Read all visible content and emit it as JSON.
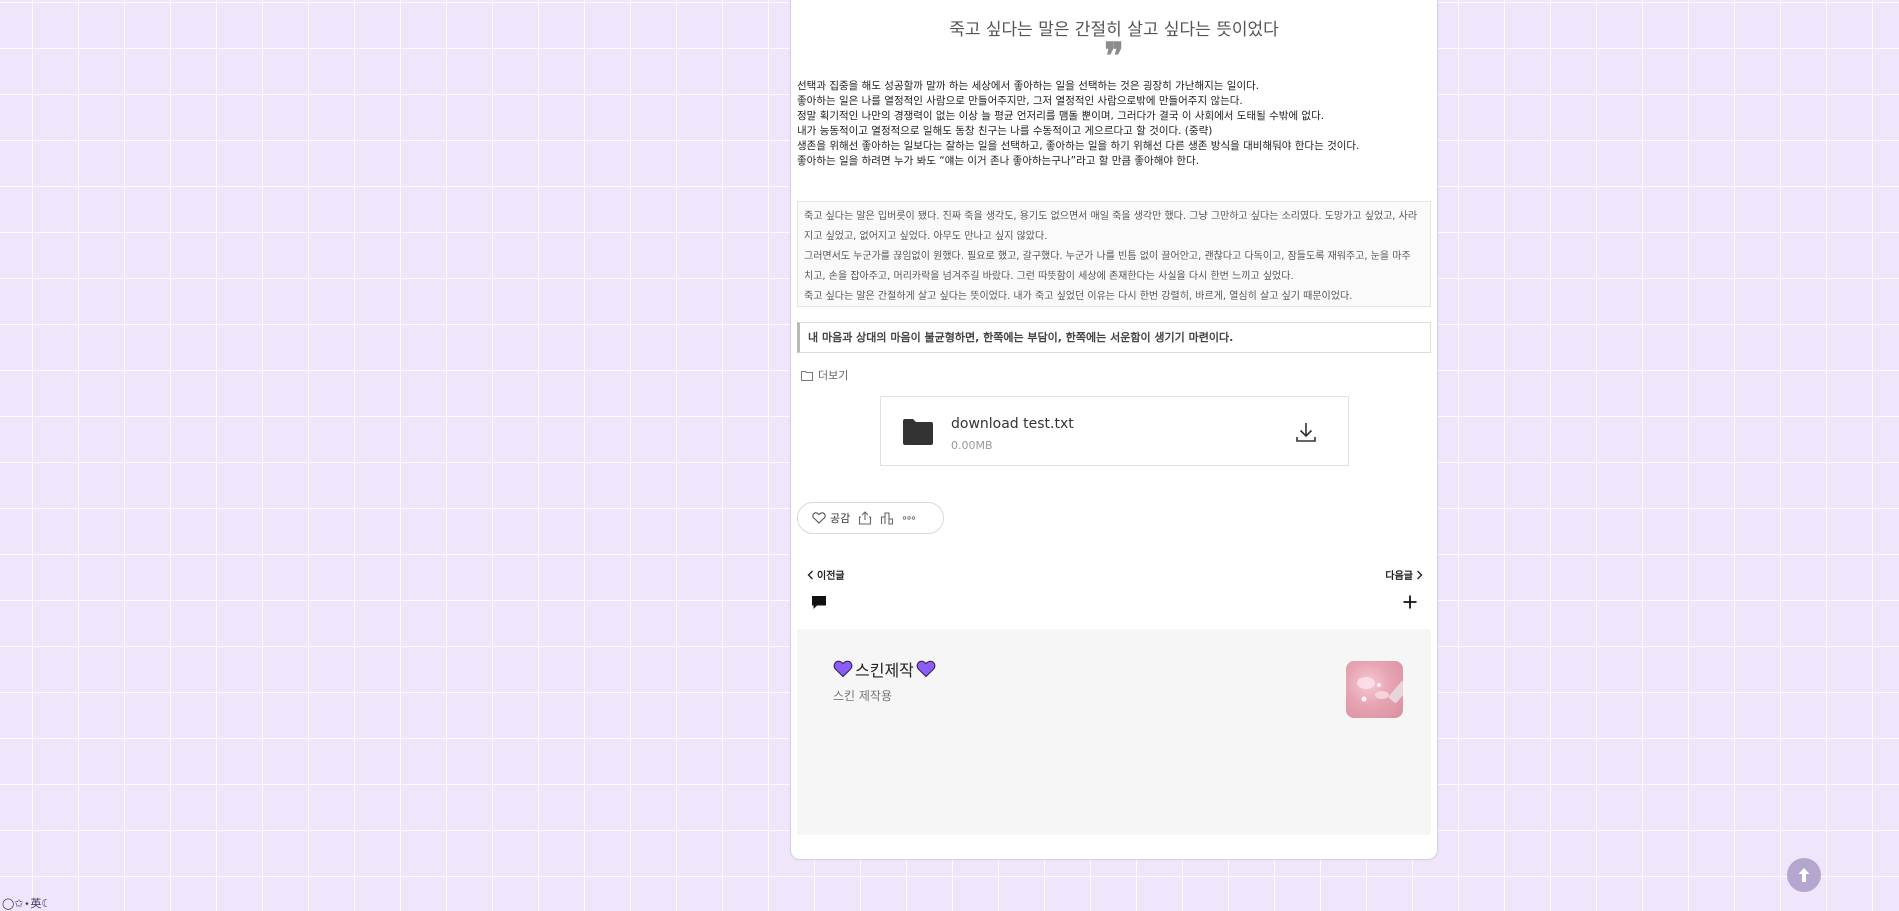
{
  "post": {
    "subtitle": "죽고 싶다는 말은 간절히 살고 싶다는 뜻이었다",
    "quote_mark": "❞",
    "quote_lines": [
      "선택과 집중을 해도 성공할까 말까 하는 세상에서 좋아하는 일을 선택하는 것은 굉장히 가난해지는 일이다.",
      "좋아하는 일은 나를 열정적인 사람으로 만들어주지만, 그저 열정적인 사람으로밖에 만들어주지 않는다.",
      "정말 획기적인 나만의 경쟁력이 없는 이상 늘 평균 언저리를 맴돌 뿐이며, 그러다가 결국 이 사회에서 도태될 수밖에 없다.",
      "내가 능동적이고 열정적으로 일해도 동창 친구는 나를 수동적이고 게으르다고 할 것이다. (중략)",
      "생존을 위해선 좋아하는 일보다는 잘하는 일을 선택하고, 좋아하는 일을 하기 위해선 다른 생존 방식을 대비해둬야 한다는 것이다.",
      "좋아하는 일을 하려면 누가 봐도 “얘는 이거 존나 좋아하는구나”라고 할 만큼 좋아해야 한다."
    ],
    "story_lines": [
      "죽고 싶다는 말은 입버릇이 됐다. 진짜 죽을 생각도, 용기도 없으면서 매일 죽을 생각만 했다. 그냥 그만하고 싶다는 소리였다. 도망가고 싶었고, 사라",
      "지고 싶었고, 없어지고 싶었다. 아무도 만나고 싶지 않았다.",
      "그러면서도 누군가를 끊임없이 원했다. 필요로 했고, 갈구했다. 누군가 나를 빈틈 없이 끌어안고, 괜찮다고 다독이고, 잠들도록 재워주고, 눈을 마주",
      "치고, 손을 잡아주고, 머리카락을 넘겨주길 바랐다. 그런 따뜻함이 세상에 존재한다는 사실을 다시 한번 느끼고 싶었다.",
      "죽고 싶다는 말은 간절하게 살고 싶다는 뜻이었다. 내가 죽고 싶었던 이유는 다시 한번 강렬히, 바르게, 열심히 살고 싶기 때문이었다."
    ],
    "highlight": "내 마음과 상대의 마음이 불균형하면, 한쪽에는 부담이, 한쪽에는 서운함이 생기기 마련이다.",
    "more_label": "더보기"
  },
  "attachment": {
    "file_name": "download test.txt",
    "file_size": "0.00MB"
  },
  "reactions": {
    "like_label": "공감",
    "icons": [
      "heart-icon",
      "share-icon",
      "stats-icon",
      "more-icon"
    ]
  },
  "navigation": {
    "prev_label": "이전글",
    "next_label": "다음글"
  },
  "author": {
    "name": "스킨제작",
    "description": "스킨 제작용",
    "heart_color": "#8b5cf6"
  },
  "footer": {
    "credit": "◯✩⋆英☾"
  },
  "colors": {
    "background": "#efe6fb",
    "grid_line": "#ffffff",
    "scroll_top_button": "#b5a6cf"
  }
}
